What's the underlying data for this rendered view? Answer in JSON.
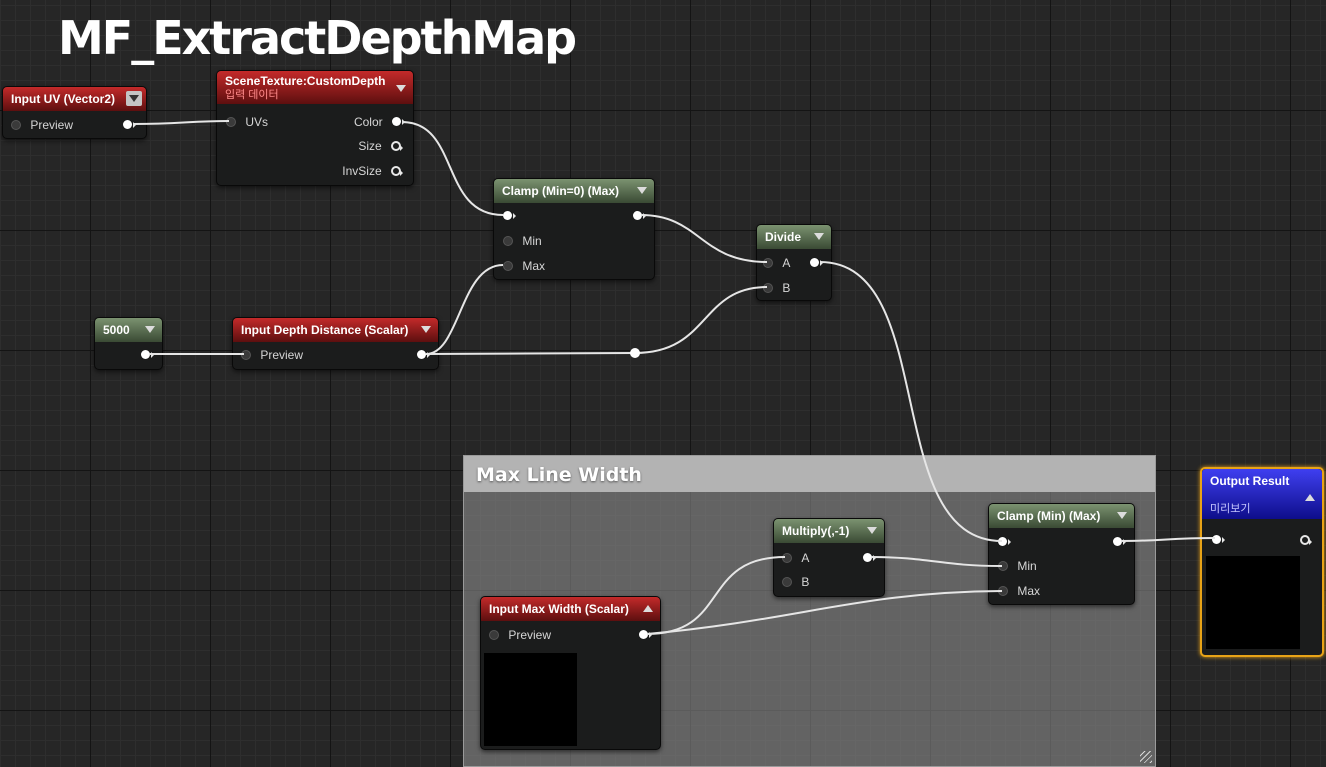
{
  "graph": {
    "title": "MF_ExtractDepthMap"
  },
  "comment": {
    "label": "Max Line Width"
  },
  "nodes": {
    "input_uv": {
      "title": "Input UV (Vector2)",
      "pin_preview": "Preview"
    },
    "scene_texture": {
      "title": "SceneTexture:CustomDepth",
      "subtitle": "입력 데이터",
      "pin_uvs": "UVs",
      "pin_color": "Color",
      "pin_size": "Size",
      "pin_invsize": "InvSize"
    },
    "clamp_min0": {
      "title": "Clamp (Min=0) (Max)",
      "pin_min": "Min",
      "pin_max": "Max"
    },
    "divide": {
      "title": "Divide",
      "pin_a": "A",
      "pin_b": "B"
    },
    "constant_5000": {
      "title": "5000"
    },
    "input_depth_distance": {
      "title": "Input Depth Distance (Scalar)",
      "pin_preview": "Preview"
    },
    "multiply": {
      "title": "Multiply(,-1)",
      "pin_a": "A",
      "pin_b": "B"
    },
    "clamp_minmax": {
      "title": "Clamp (Min) (Max)",
      "pin_min": "Min",
      "pin_max": "Max"
    },
    "input_max_width": {
      "title": "Input Max Width (Scalar)",
      "pin_preview": "Preview"
    },
    "output_result": {
      "title": "Output Result",
      "subtitle": "미리보기"
    }
  },
  "colors": {
    "input_header": "#a31d1d",
    "math_header": "#5b6e53",
    "output_header": "#1f1fc4",
    "selection_outline": "#e8a317",
    "wire": "#e6e6e6"
  }
}
